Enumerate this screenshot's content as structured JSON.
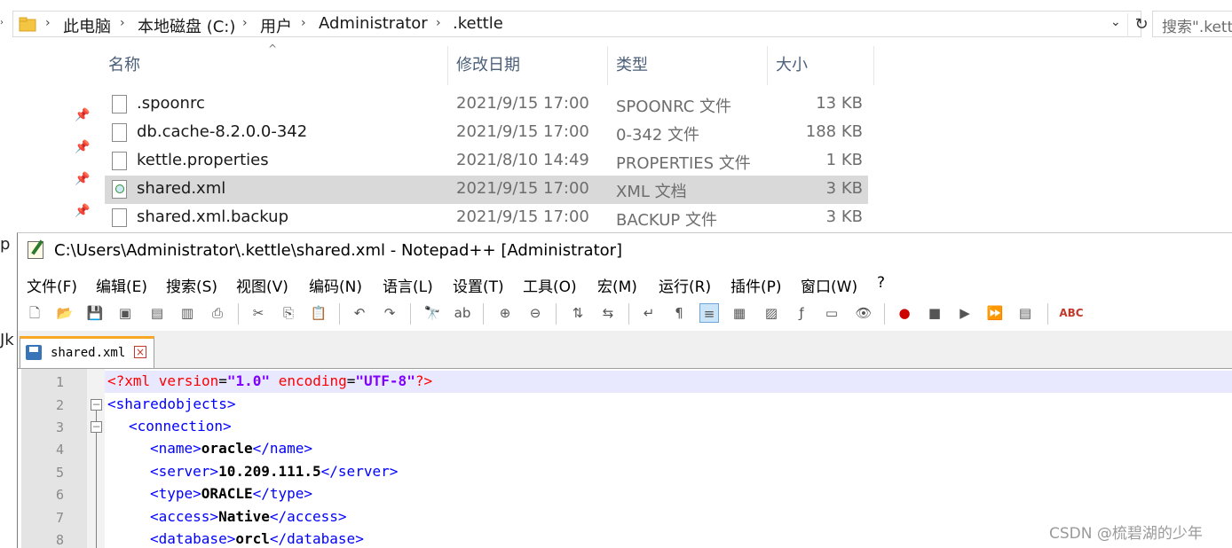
{
  "explorer": {
    "breadcrumbs": [
      "此电脑",
      "本地磁盘 (C:)",
      "用户",
      "Administrator",
      ".kettle"
    ],
    "search_placeholder": "搜索\".kettle\"",
    "columns": {
      "name": "名称",
      "date": "修改日期",
      "type": "类型",
      "size": "大小"
    },
    "files": [
      {
        "name": ".spoonrc",
        "date": "2021/9/15 17:00",
        "type": "SPOONRC 文件",
        "size": "13 KB",
        "icon": "file-icon",
        "selected": false
      },
      {
        "name": "db.cache-8.2.0.0-342",
        "date": "2021/9/15 17:00",
        "type": "0-342 文件",
        "size": "188 KB",
        "icon": "file-icon",
        "selected": false
      },
      {
        "name": "kettle.properties",
        "date": "2021/8/10 14:49",
        "type": "PROPERTIES 文件",
        "size": "1 KB",
        "icon": "file-icon",
        "selected": false
      },
      {
        "name": "shared.xml",
        "date": "2021/9/15 17:00",
        "type": "XML 文档",
        "size": "3 KB",
        "icon": "xml-file-icon",
        "selected": true
      },
      {
        "name": "shared.xml.backup",
        "date": "2021/9/15 17:00",
        "type": "BACKUP 文件",
        "size": "3 KB",
        "icon": "file-icon",
        "selected": false
      }
    ],
    "side_stubs": [
      "p",
      "Jk"
    ]
  },
  "notepad": {
    "title": "C:\\Users\\Administrator\\.kettle\\shared.xml - Notepad++ [Administrator]",
    "menu": [
      "文件(F)",
      "编辑(E)",
      "搜索(S)",
      "视图(V)",
      "编码(N)",
      "语言(L)",
      "设置(T)",
      "工具(O)",
      "宏(M)",
      "运行(R)",
      "插件(P)",
      "窗口(W)",
      "?"
    ],
    "tab_label": "shared.xml",
    "line_numbers": [
      "1",
      "2",
      "3",
      "4",
      "5",
      "6",
      "7",
      "8"
    ],
    "code": {
      "l1": {
        "open": "<?xml ",
        "a1": "version",
        "eq1": "=",
        "v1": "\"1.0\"",
        "sp": " ",
        "a2": "encoding",
        "eq2": "=",
        "v2": "\"UTF-8\"",
        "close": "?>"
      },
      "l2": {
        "tag": "<sharedobjects>"
      },
      "l3": {
        "tag": "<connection>"
      },
      "l4": {
        "open": "<name>",
        "text": "oracle",
        "close": "</name>"
      },
      "l5": {
        "open": "<server>",
        "text": "10.209.111.5",
        "close": "</server>"
      },
      "l6": {
        "open": "<type>",
        "text": "ORACLE",
        "close": "</type>"
      },
      "l7": {
        "open": "<access>",
        "text": "Native",
        "close": "</access>"
      },
      "l8": {
        "open": "<database>",
        "text": "orcl",
        "close": "</database>"
      }
    },
    "toolbar_icons": [
      "new-file-icon",
      "open-file-icon",
      "save-icon",
      "save-all-icon",
      "close-icon",
      "close-all-icon",
      "print-icon",
      "cut-icon",
      "copy-icon",
      "paste-icon",
      "undo-icon",
      "redo-icon",
      "find-icon",
      "replace-icon",
      "zoom-in-icon",
      "zoom-out-icon",
      "sync-vertical-icon",
      "sync-horizontal-icon",
      "word-wrap-icon",
      "show-all-chars-icon",
      "indent-guide-icon",
      "doc-map-icon",
      "function-list-icon",
      "folder-workspace-icon",
      "monitoring-icon",
      "eye-icon",
      "record-macro-icon",
      "stop-macro-icon",
      "play-macro-icon",
      "run-macro-multiple-icon",
      "save-macro-icon",
      "spell-check-icon"
    ],
    "spellcheck_label": "ABC"
  },
  "watermark": "CSDN @梳碧湖的少年"
}
